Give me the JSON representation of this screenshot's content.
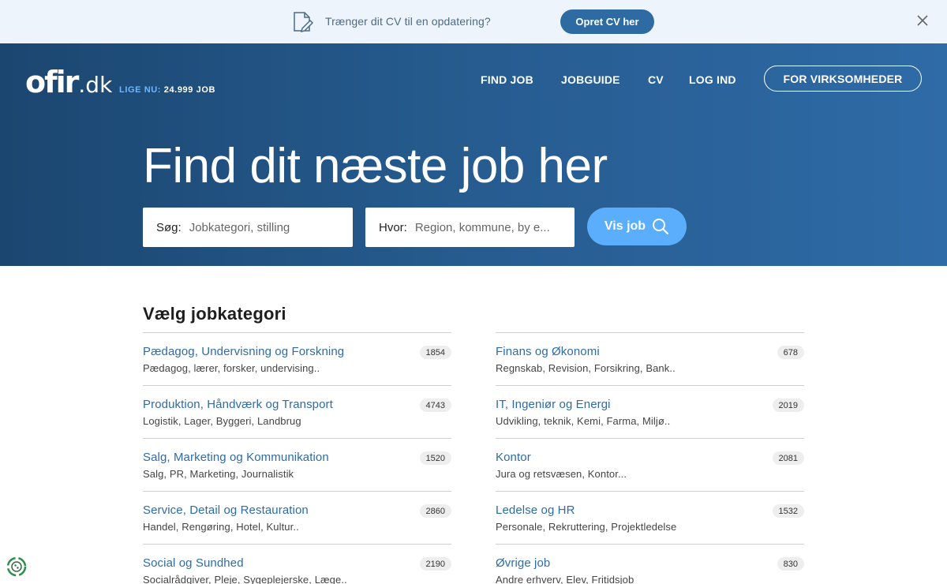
{
  "banner": {
    "icon": "document-edit-icon",
    "text": "Trænger dit CV til en opdatering?",
    "button_label": "Opret CV her",
    "close_icon": "close-icon"
  },
  "header": {
    "logo_main": "ofir",
    "logo_suffix": ".dk",
    "live_label": "LIGE NU:",
    "live_value": "24.999 JOB",
    "nav": [
      {
        "label": "FIND JOB"
      },
      {
        "label": "JOBGUIDE"
      },
      {
        "label": "CV"
      },
      {
        "label": "LOG IND"
      }
    ],
    "cta_label": "FOR VIRKSOMHEDER"
  },
  "hero": {
    "title": "Find dit næste job her",
    "search": {
      "label": "Søg:",
      "placeholder": "Jobkategori, stilling"
    },
    "where": {
      "label": "Hvor:",
      "placeholder": "Region, kommune, by e..."
    },
    "button_label": "Vis job",
    "button_icon": "search-icon"
  },
  "categories": {
    "title": "Vælg jobkategori",
    "left": [
      {
        "name": "Pædagog, Undervisning og Forskning",
        "sub": "Pædagog, lærer, forsker, undervising..",
        "count": "1854"
      },
      {
        "name": "Produktion, Håndværk og Transport",
        "sub": "Logistik, Lager, Byggeri, Landbrug",
        "count": "4743"
      },
      {
        "name": "Salg, Marketing og Kommunikation",
        "sub": "Salg, PR, Marketing, Journalistik",
        "count": "1520"
      },
      {
        "name": "Service, Detail og Restauration",
        "sub": "Handel, Rengøring, Hotel, Kultur..",
        "count": "2860"
      },
      {
        "name": "Social og Sundhed",
        "sub": "Socialrådgiver, Pleje, Sygeplejerske, Læge..",
        "count": "2190"
      }
    ],
    "right": [
      {
        "name": "Finans og Økonomi",
        "sub": "Regnskab, Revision, Forsikring, Bank..",
        "count": "678"
      },
      {
        "name": "IT, Ingeniør og Energi",
        "sub": "Udvikling, teknik, Kemi, Farma, Miljø..",
        "count": "2019"
      },
      {
        "name": "Kontor",
        "sub": "Jura og retsvæsen, Kontor...",
        "count": "2081"
      },
      {
        "name": "Ledelse og HR",
        "sub": "Personale, Rekruttering, Projektledelse",
        "count": "1532"
      },
      {
        "name": "Øvrige job",
        "sub": "Andre erhverv, Elev, Fritidsjob",
        "count": "830"
      }
    ]
  },
  "colors": {
    "brand_blue": "#2f6ba3",
    "accent_light_blue": "#5aaefc",
    "link_blue": "#2e6ca6"
  },
  "cookie_icon": "cookie-settings-icon"
}
